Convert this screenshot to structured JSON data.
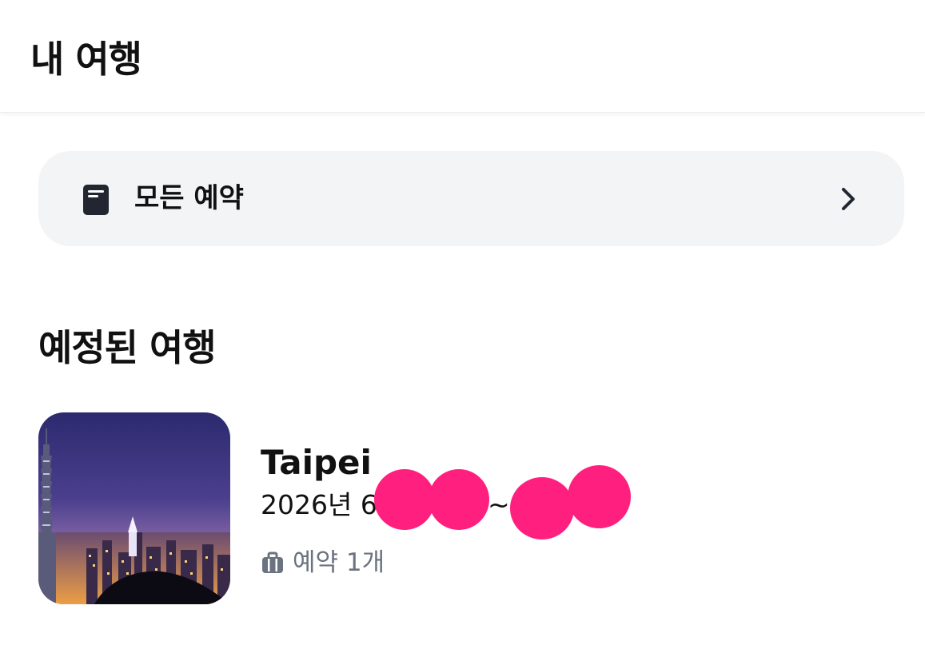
{
  "header": {
    "title": "내 여행"
  },
  "all_bookings": {
    "label": "모든 예약",
    "icon": "book-icon",
    "chevron_icon": "chevron-right-icon"
  },
  "upcoming": {
    "title": "예정된 여행",
    "trips": [
      {
        "city": "Taipei",
        "dates": "2026년 6",
        "dates_separator": "~",
        "bookings_label": "예약 1개",
        "bookings_icon": "suitcase-icon",
        "thumbnail": "taipei-night-skyline"
      }
    ]
  },
  "colors": {
    "accent_dark": "#222631",
    "card_bg": "#f3f4f6",
    "muted_text": "#6b7280",
    "redaction": "#ff1f7f"
  }
}
